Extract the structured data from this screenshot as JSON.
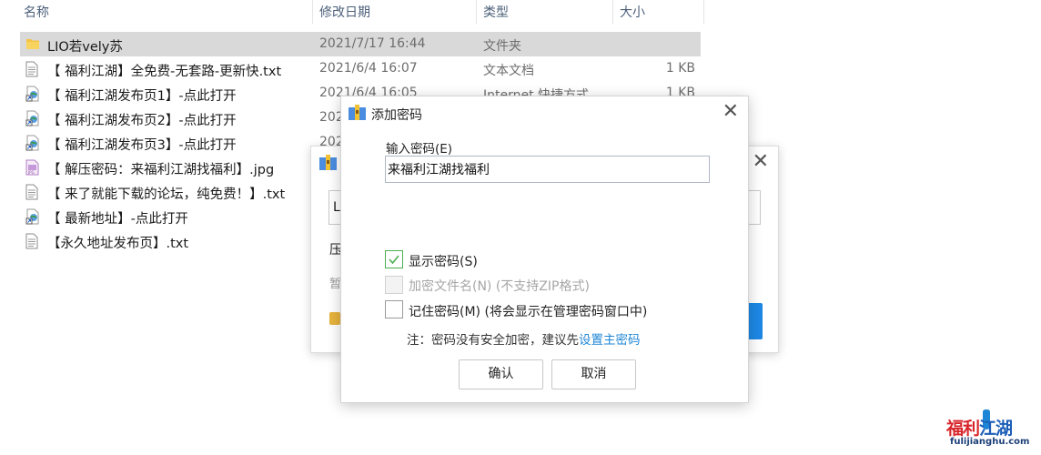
{
  "explorer": {
    "columns": {
      "name": "名称",
      "modified": "修改日期",
      "type": "类型",
      "size": "大小"
    },
    "files": [
      {
        "icon": "folder-icon",
        "name": "LIO若vely苏",
        "date": "2021/7/17 16:44",
        "type": "文件夹",
        "size": "",
        "selected": true
      },
      {
        "icon": "text-file-icon",
        "name": "【 福利江湖】全免费-无套路-更新快.txt",
        "date": "2021/6/4 16:07",
        "type": "文本文档",
        "size": "1 KB"
      },
      {
        "icon": "internet-shortcut-icon",
        "name": "【 福利江湖发布页1】-点此打开",
        "date": "2021/6/4 16:05",
        "type": "Internet 快捷方式",
        "size": "1 KB"
      },
      {
        "icon": "internet-shortcut-icon",
        "name": "【 福利江湖发布页2】-点此打开",
        "date": "202",
        "type": "",
        "size": ""
      },
      {
        "icon": "internet-shortcut-icon",
        "name": "【 福利江湖发布页3】-点此打开",
        "date": "202",
        "type": "",
        "size": ""
      },
      {
        "icon": "image-file-icon",
        "name": "【 解压密码：来福利江湖找福利】.jpg",
        "date": "",
        "type": "",
        "size": ""
      },
      {
        "icon": "text-file-icon",
        "name": "【 来了就能下载的论坛，纯免费！】.txt",
        "date": "",
        "type": "",
        "size": ""
      },
      {
        "icon": "internet-shortcut-icon",
        "name": "【 最新地址】-点此打开",
        "date": "",
        "type": "",
        "size": ""
      },
      {
        "icon": "text-file-icon",
        "name": "【永久地址发布页】.txt",
        "date": "",
        "type": "",
        "size": ""
      }
    ]
  },
  "back_dialog": {
    "input_text": "L",
    "text1": "压",
    "text2": "暂"
  },
  "dialog": {
    "title": "添加密码",
    "password_label": "输入密码(E)",
    "password_value": "来福利江湖找福利",
    "show_password": {
      "label": "显示密码(S)",
      "checked": true
    },
    "encrypt_names": {
      "label": "加密文件名(N) (不支持ZIP格式)",
      "checked": false,
      "disabled": true
    },
    "remember_password": {
      "label": "记住密码(M) (将会显示在管理密码窗口中)",
      "checked": false
    },
    "note_prefix": "注：密码没有安全加密，建议先",
    "note_link": "设置主密码",
    "ok_label": "确认",
    "cancel_label": "取消"
  },
  "watermark": {
    "text_main_red": "福利",
    "text_main_blue": "江湖",
    "url": "fulijianghu.com"
  },
  "colors": {
    "accent_blue": "#1f86d6",
    "check_green": "#4caf50",
    "selected_row": "#d9d9d9"
  }
}
